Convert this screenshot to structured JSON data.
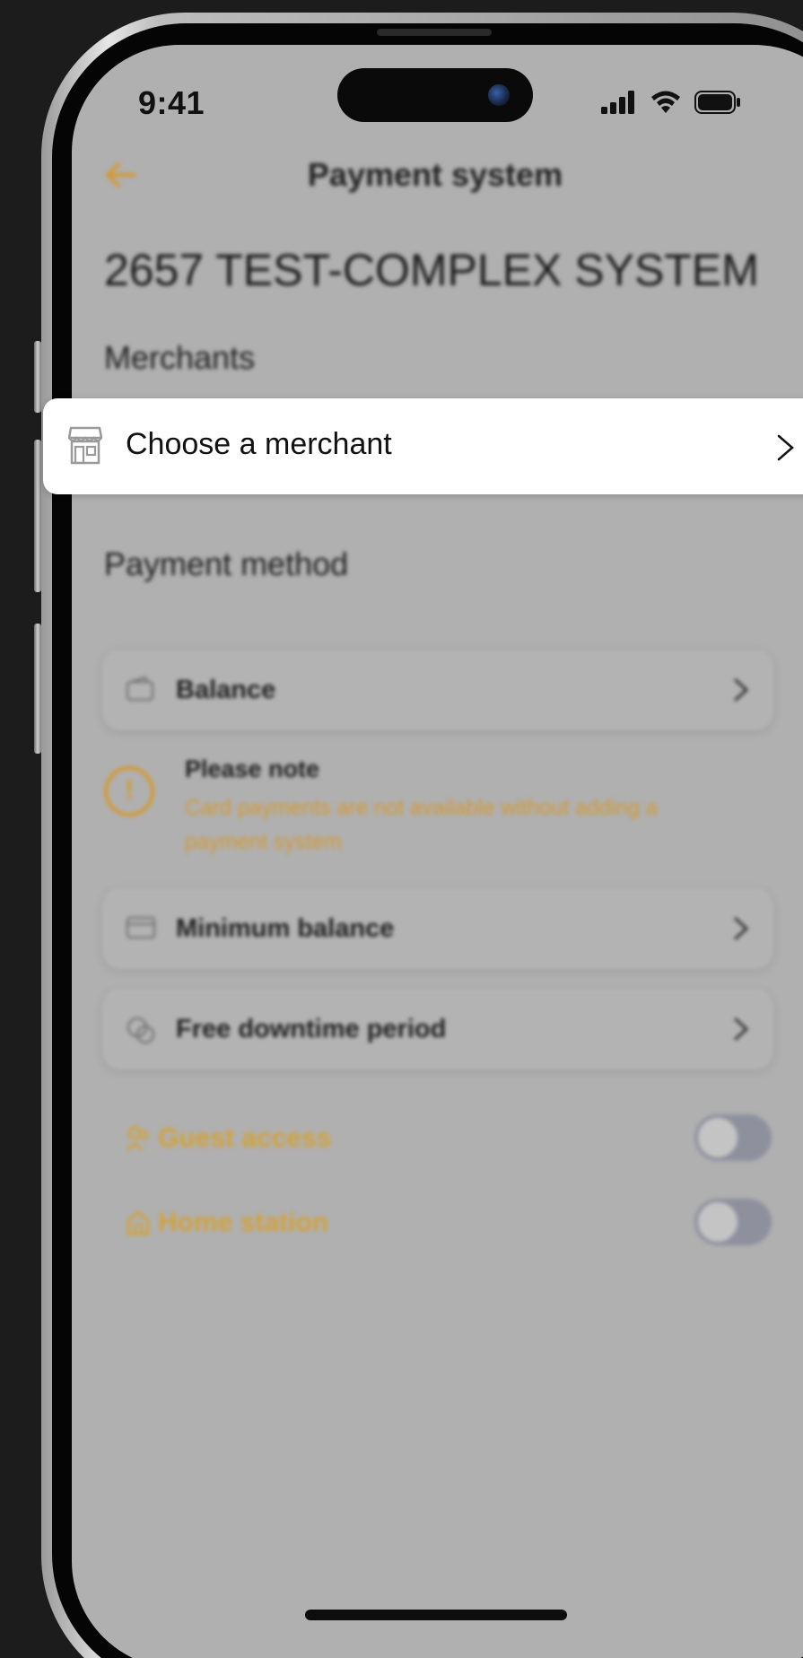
{
  "status_bar": {
    "time": "9:41",
    "icons": [
      "cellular-signal-icon",
      "wifi-icon",
      "battery-icon"
    ]
  },
  "header": {
    "back_icon": "arrow-left-icon",
    "title": "Payment system"
  },
  "system_name": "2657 TEST-COMPLEX SYSTEM",
  "merchants": {
    "section_label": "Merchants",
    "choose_label": "Choose a merchant",
    "icon": "store-icon"
  },
  "payment_method": {
    "section_label": "Payment method",
    "balance_label": "Balance"
  },
  "note": {
    "title": "Please note",
    "text": "Card payments are not available without adding a payment system"
  },
  "settings": {
    "minimum_balance_label": "Minimum balance",
    "free_downtime_label": "Free downtime period"
  },
  "toggles": {
    "guest_access": {
      "label": "Guest access",
      "enabled": false
    },
    "home_station": {
      "label": "Home station",
      "enabled": false
    }
  },
  "colors": {
    "accent": "#d29a33",
    "background_overlay": "#b0b0b0",
    "card_highlight": "#ffffff"
  }
}
